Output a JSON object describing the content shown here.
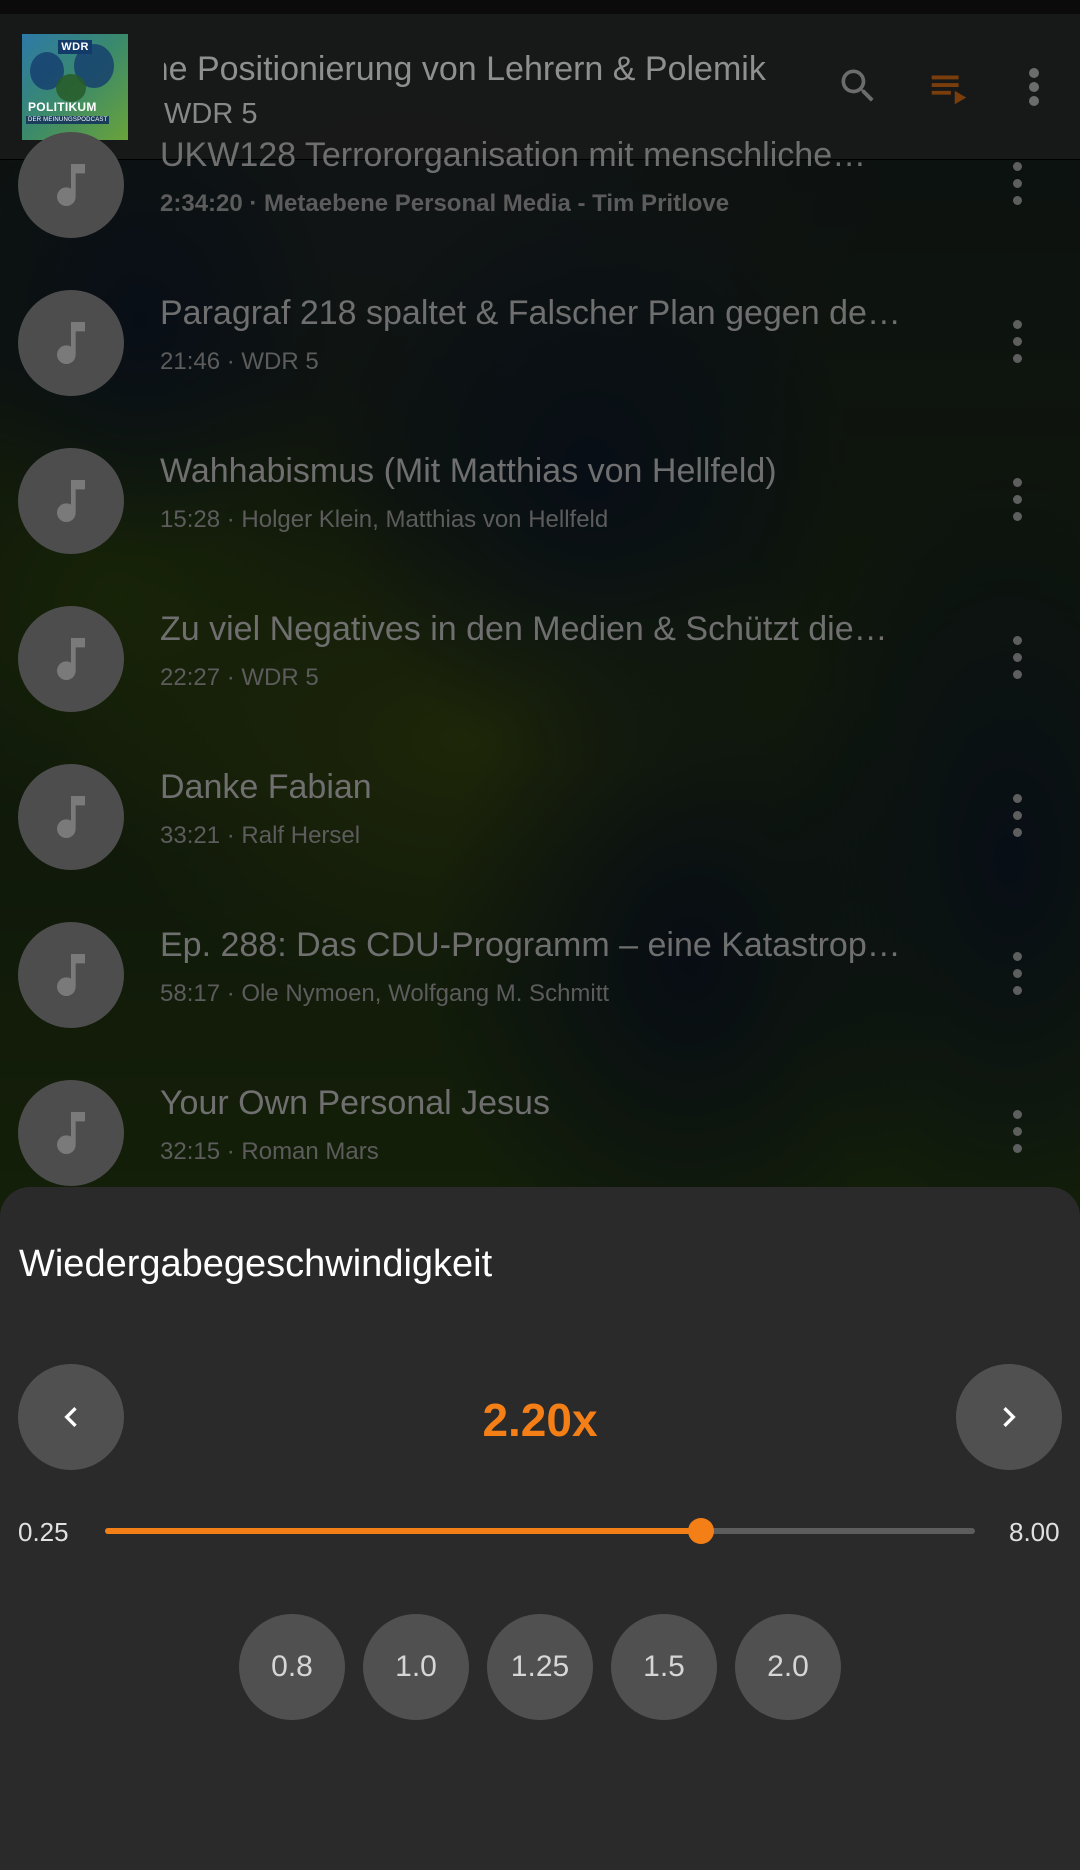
{
  "now_playing": {
    "title": "Politische Positionierung von Lehrern & Polemik",
    "podcast": "WDR 5",
    "cover": {
      "brand": "WDR",
      "title": "POLITIKUM",
      "subtitle": "DER MEINUNGSPODCAST"
    }
  },
  "toolbar": {
    "search_icon": "search-icon",
    "queue_icon": "playlist-play-icon",
    "more_icon": "more-vert-icon"
  },
  "episodes": [
    {
      "title": "UKW128 Terrororganisation mit menschliche…",
      "meta": "2:34:20 · Metaebene Personal Media - Tim Pritlove"
    },
    {
      "title": "Paragraf 218 spaltet & Falscher Plan gegen de…",
      "meta": "21:46 · WDR 5"
    },
    {
      "title": "Wahhabismus (Mit Matthias von Hellfeld)",
      "meta": "15:28 · Holger Klein, Matthias von Hellfeld"
    },
    {
      "title": "Zu viel Negatives in den Medien &  Schützt die…",
      "meta": "22:27 · WDR 5"
    },
    {
      "title": "Danke Fabian",
      "meta": "33:21 · Ralf Hersel"
    },
    {
      "title": "Ep. 288: Das CDU-Programm – eine Katastrop…",
      "meta": "58:17 · Ole Nymoen, Wolfgang M. Schmitt"
    },
    {
      "title": "Your Own Personal Jesus",
      "meta": "32:15 · Roman Mars"
    }
  ],
  "speed_sheet": {
    "title": "Wiedergabegeschwindigkeit",
    "current": "2.20x",
    "current_value": 2.2,
    "min_label": "0.25",
    "max_label": "8.00",
    "min": 0.25,
    "max": 8.0,
    "slider_position": 0.685,
    "presets": [
      "0.8",
      "1.0",
      "1.25",
      "1.5",
      "2.0"
    ]
  },
  "colors": {
    "accent": "#f57f17",
    "sheet_bg": "#2a2a2a",
    "button_bg": "#505050"
  }
}
